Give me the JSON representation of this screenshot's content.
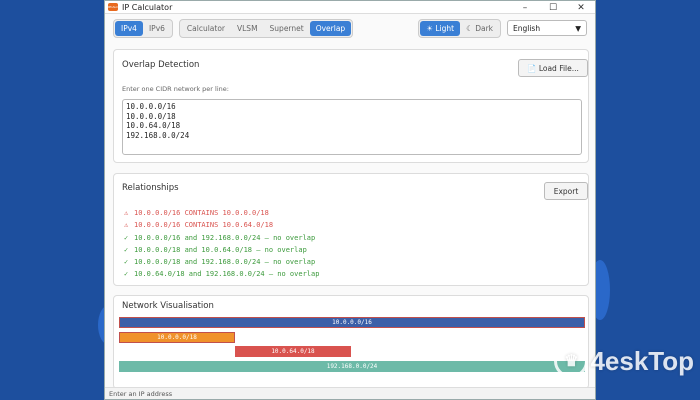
{
  "window": {
    "title": "IP Calculator",
    "icon_text": "IPCALC"
  },
  "toolbar": {
    "ip_versions": [
      "IPv4",
      "IPv6"
    ],
    "modes": [
      "Calculator",
      "VLSM",
      "Supernet",
      "Overlap"
    ],
    "themes": [
      "☀ Light",
      "☾ Dark"
    ],
    "language": "English"
  },
  "overlap": {
    "title": "Overlap Detection",
    "load_button": "📄 Load File...",
    "hint": "Enter one CIDR network per line:",
    "networks": [
      "10.0.0.0/16",
      "10.0.0.0/18",
      "10.0.64.0/18",
      "192.168.0.0/24"
    ]
  },
  "relationships": {
    "title": "Relationships",
    "export_button": "Export",
    "items": [
      {
        "mark": "⚠",
        "text": "10.0.0.0/16 CONTAINS 10.0.0.0/18",
        "status": "warn"
      },
      {
        "mark": "⚠",
        "text": "10.0.0.0/16 CONTAINS 10.0.64.0/18",
        "status": "warn"
      },
      {
        "mark": "✓",
        "text": "10.0.0.0/16 and 192.168.0.0/24 — no overlap",
        "status": "ok"
      },
      {
        "mark": "✓",
        "text": "10.0.0.0/18 and 10.0.64.0/18 — no overlap",
        "status": "ok"
      },
      {
        "mark": "✓",
        "text": "10.0.0.0/18 and 192.168.0.0/24 — no overlap",
        "status": "ok"
      },
      {
        "mark": "✓",
        "text": "10.0.64.0/18 and 192.168.0.0/24 — no overlap",
        "status": "ok"
      }
    ]
  },
  "visualisation": {
    "title": "Network Visualisation",
    "bars": [
      {
        "label": "10.0.0.0/16",
        "color": "#3b5fa8"
      },
      {
        "label": "10.0.0.0/18",
        "color": "#f0922b"
      },
      {
        "label": "10.0.64.0/18",
        "color": "#d9534f"
      },
      {
        "label": "192.168.0.0/24",
        "color": "#6dbaa8"
      }
    ]
  },
  "status": {
    "placeholder": "Enter an IP address"
  },
  "watermark": {
    "badge": "♛",
    "text": "4eskTop"
  },
  "colors": {
    "accent": "#3a7fd5",
    "warn": "#d9534f",
    "ok": "#3c9a3c"
  }
}
